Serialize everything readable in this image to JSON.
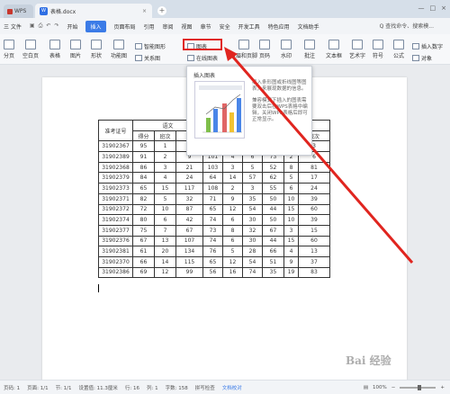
{
  "titlebar": {
    "app_tab": "WPS",
    "doc_tab": "表格.docx",
    "close_glyph": "×",
    "add_glyph": "+",
    "win_controls": [
      "—",
      "□",
      "×"
    ]
  },
  "menu": {
    "file": "三 文件",
    "items": [
      "开始",
      "插入",
      "页面布局",
      "引用",
      "审阅",
      "视图",
      "章节",
      "安全",
      "开发工具",
      "特色应用",
      "文档助手"
    ],
    "active": "插入",
    "search": "Q 查找命令、搜索模..."
  },
  "ribbon": {
    "labels": [
      "分页",
      "空白页",
      "表格",
      "图片",
      "形状",
      "功能图",
      "关系图"
    ],
    "smart_graphic": "智能图形",
    "chart": "图表",
    "online_chart": "在线图表",
    "page_header_footer": "页眉和页脚",
    "page_number": "页码",
    "watermark": "水印",
    "annotation": "批注",
    "textbox": "文本框",
    "art_text": "艺术字",
    "symbol": "符号",
    "formula": "公式",
    "insert_number": "插入数字",
    "object": "对象"
  },
  "tooltip": {
    "title": "插入图表",
    "desc_1": "插入条形图或折线图等图表，来展现数据的信息。",
    "desc_2": "兼容模式下插入的图表需要双击后在WPS表格中编辑，关闭WPS表格后即可正常显示。"
  },
  "table": {
    "header_top": [
      "准考证号",
      "语文",
      "语"
    ],
    "header_sub": [
      "得分",
      "班次",
      "校次"
    ],
    "rows": [
      [
        "31902367",
        "95",
        "1",
        "3",
        "110",
        "1",
        "1",
        "79",
        "1",
        "3"
      ],
      [
        "31902389",
        "91",
        "2",
        "9",
        "101",
        "4",
        "6",
        "73",
        "2",
        "6"
      ],
      [
        "31902368",
        "86",
        "3",
        "21",
        "103",
        "3",
        "5",
        "52",
        "8",
        "81"
      ],
      [
        "31902379",
        "84",
        "4",
        "24",
        "64",
        "14",
        "57",
        "62",
        "5",
        "17"
      ],
      [
        "31902373",
        "65",
        "15",
        "117",
        "108",
        "2",
        "3",
        "55",
        "6",
        "24"
      ],
      [
        "31902371",
        "82",
        "5",
        "32",
        "71",
        "9",
        "35",
        "50",
        "10",
        "39"
      ],
      [
        "31902372",
        "72",
        "10",
        "87",
        "65",
        "12",
        "54",
        "44",
        "15",
        "60"
      ],
      [
        "31902374",
        "80",
        "6",
        "42",
        "74",
        "6",
        "30",
        "50",
        "10",
        "39"
      ],
      [
        "31902377",
        "75",
        "7",
        "67",
        "73",
        "8",
        "32",
        "67",
        "3",
        "15"
      ],
      [
        "31902376",
        "67",
        "13",
        "107",
        "74",
        "6",
        "30",
        "44",
        "15",
        "60"
      ],
      [
        "31902381",
        "61",
        "20",
        "134",
        "76",
        "5",
        "28",
        "66",
        "4",
        "13"
      ],
      [
        "31902370",
        "66",
        "14",
        "115",
        "65",
        "12",
        "54",
        "51",
        "9",
        "37"
      ],
      [
        "31902386",
        "69",
        "12",
        "99",
        "56",
        "16",
        "74",
        "35",
        "19",
        "83"
      ]
    ]
  },
  "statusbar": {
    "page_num": "页码: 1",
    "pages": "页面: 1/1",
    "section": "节: 1/1",
    "setting": "设置值: 11.3厘米",
    "row": "行: 16",
    "col": "列: 1",
    "words": "字数: 158",
    "spell": "拼写检查",
    "doc_proof": "文档校对",
    "zoom": "100%"
  },
  "colors": {
    "accent": "#3b7be7",
    "highlight": "#e0251f"
  }
}
